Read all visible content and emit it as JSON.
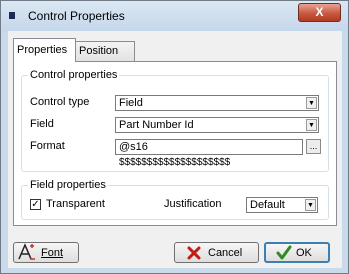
{
  "window": {
    "title": "Control Properties",
    "close_label": "X"
  },
  "tabs": [
    {
      "label": "Properties"
    },
    {
      "label": "Position"
    }
  ],
  "control_properties": {
    "legend": "Control properties",
    "control_type_label": "Control type",
    "control_type_value": "Field",
    "field_label": "Field",
    "field_value": "Part Number Id",
    "format_label": "Format",
    "format_value": "@s16",
    "format_button": "...",
    "format_preview": "$$$$$$$$$$$$$$$$$$$$"
  },
  "field_properties": {
    "legend": "Field properties",
    "transparent_label": "Transparent",
    "transparent_checked": true,
    "justification_label": "Justification",
    "justification_value": "Default"
  },
  "buttons": {
    "font": "Font",
    "cancel": "Cancel",
    "ok": "OK"
  },
  "colors": {
    "ok_check": "#2e8b22",
    "cancel_x": "#c21d12",
    "font_icon": "#c0392b"
  }
}
